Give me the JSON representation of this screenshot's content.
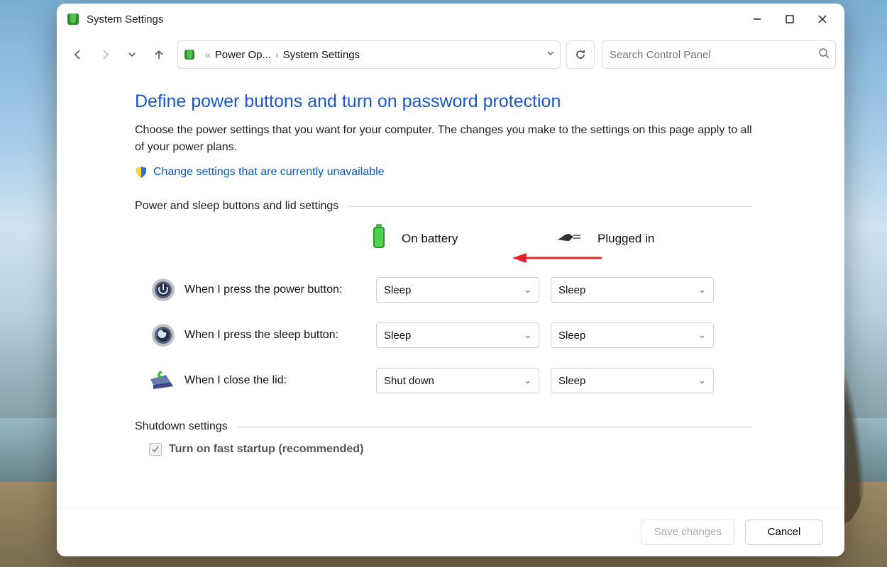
{
  "window": {
    "title": "System Settings"
  },
  "breadcrumb": {
    "prefix": "«",
    "p1": "Power Op...",
    "p2": "System Settings"
  },
  "search": {
    "placeholder": "Search Control Panel"
  },
  "page": {
    "heading": "Define power buttons and turn on password protection",
    "description": "Choose the power settings that you want for your computer. The changes you make to the settings on this page apply to all of your power plans.",
    "change_link": "Change settings that are currently unavailable"
  },
  "sections": {
    "buttons_title": "Power and sleep buttons and lid settings",
    "shutdown_title": "Shutdown settings"
  },
  "columns": {
    "battery": "On battery",
    "plugged": "Plugged in"
  },
  "rows": {
    "power": {
      "label": "When I press the power button:",
      "battery": "Sleep",
      "plugged": "Sleep"
    },
    "sleep": {
      "label": "When I press the sleep button:",
      "battery": "Sleep",
      "plugged": "Sleep"
    },
    "lid": {
      "label": "When I close the lid:",
      "battery": "Shut down",
      "plugged": "Sleep"
    }
  },
  "shutdown": {
    "fast_startup": "Turn on fast startup (recommended)",
    "fast_startup_checked": true
  },
  "footer": {
    "save": "Save changes",
    "cancel": "Cancel"
  }
}
